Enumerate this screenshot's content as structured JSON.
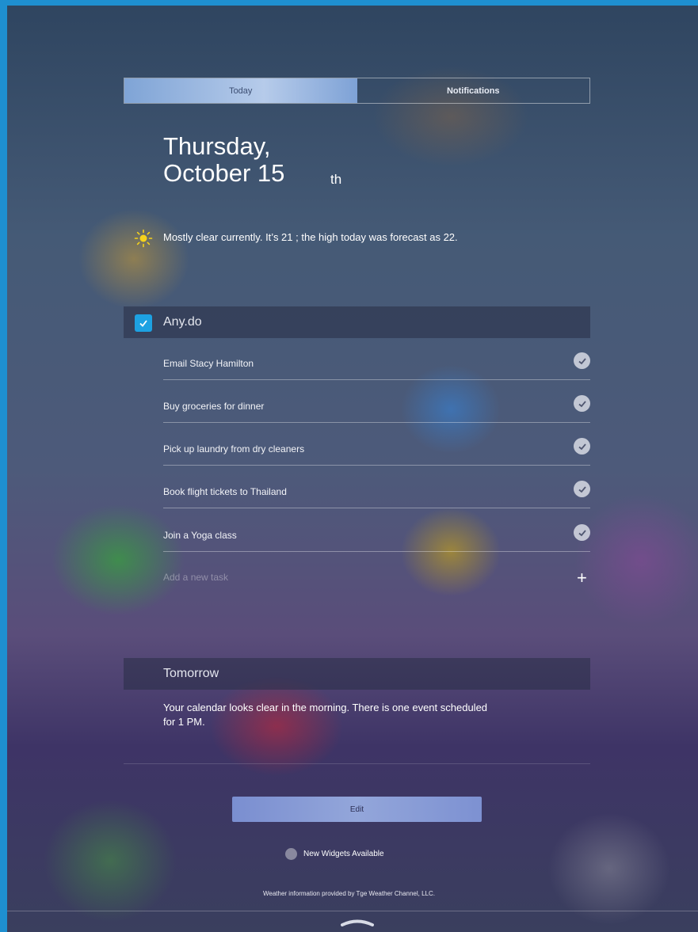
{
  "tabs": [
    {
      "label": "Today",
      "active": true
    },
    {
      "label": "Notifications",
      "active": false
    }
  ],
  "date": {
    "line1": "Thursday,",
    "line2": "October 15",
    "suffix": "th"
  },
  "weather": {
    "icon": "sun-icon",
    "text": "Mostly clear currently. It’s 21 ; the high today was forecast as 22."
  },
  "anydo": {
    "title": "Any.do",
    "tasks": [
      {
        "label": "Email Stacy Hamilton"
      },
      {
        "label": "Buy groceries for dinner"
      },
      {
        "label": "Pick up laundry from dry cleaners"
      },
      {
        "label": "Book flight tickets to Thailand"
      },
      {
        "label": "Join a Yoga class"
      }
    ],
    "add_placeholder": "Add a new task"
  },
  "tomorrow": {
    "title": "Tomorrow",
    "text": "Your calendar looks clear in the morning. There is one event scheduled for 1 PM."
  },
  "edit_label": "Edit",
  "new_widgets": "New Widgets Available",
  "credit": "Weather information provided by Tge Weather Channel, LLC.",
  "colors": {
    "accent": "#1da1e2",
    "frame": "#1e8fd0",
    "edit_button": "#8a9dd6"
  }
}
